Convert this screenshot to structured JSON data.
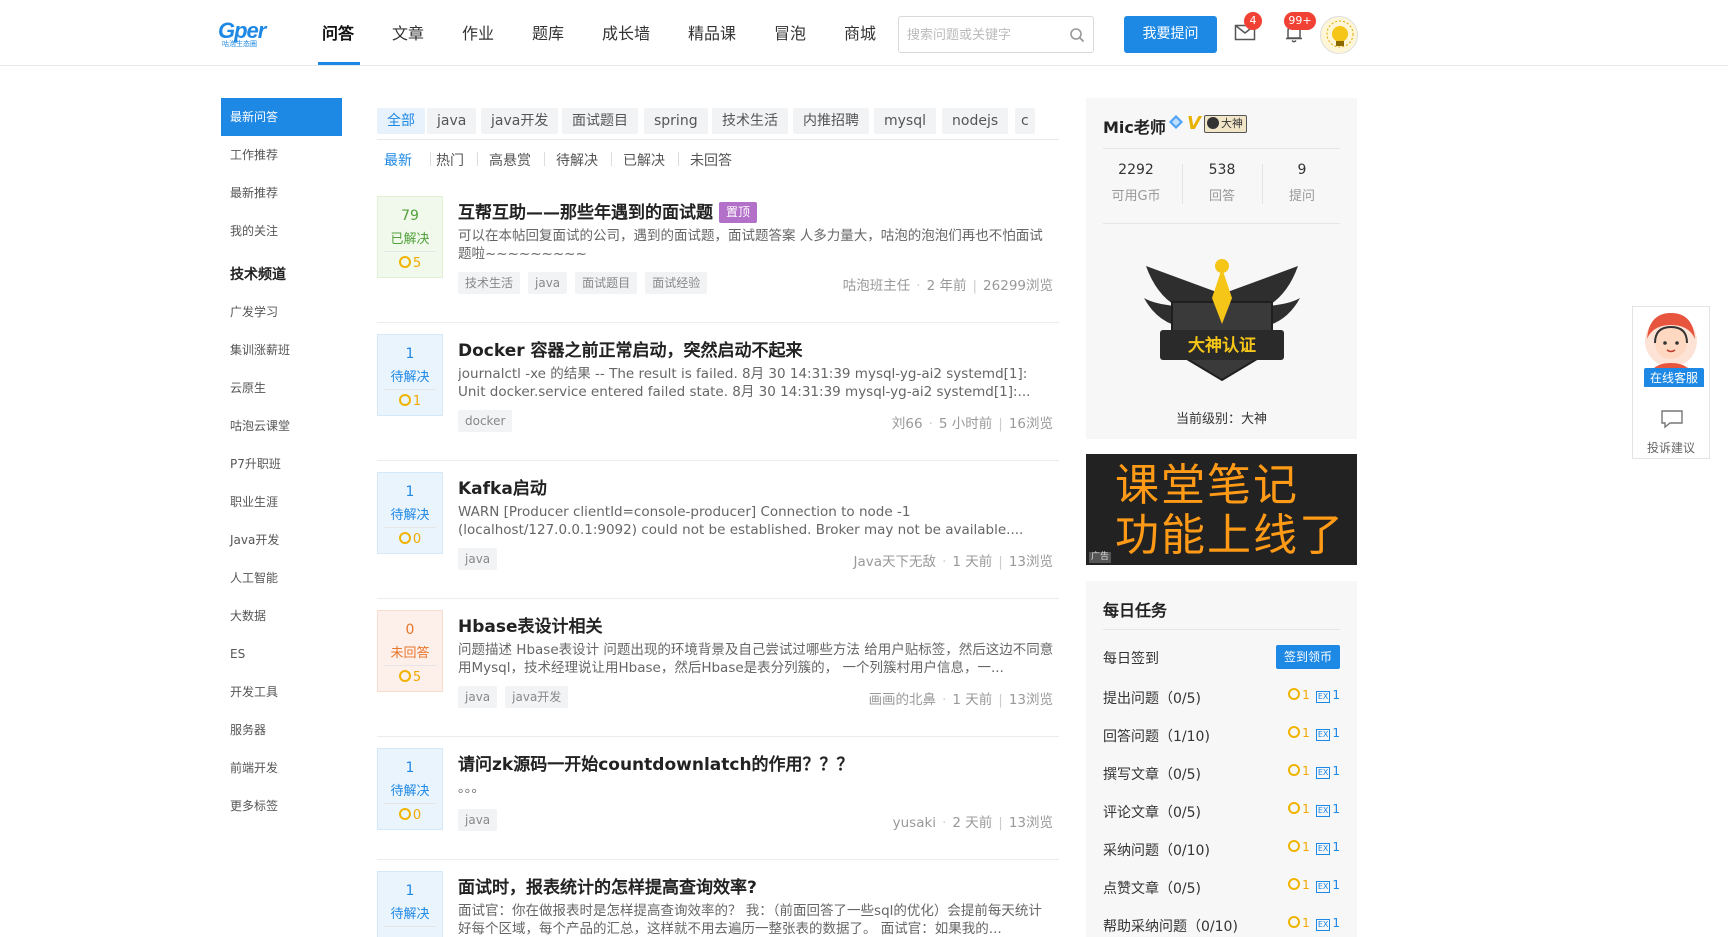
{
  "header": {
    "logo_text": "Gper",
    "logo_sub": "咕泡生态圈",
    "nav": [
      "问答",
      "文章",
      "作业",
      "题库",
      "成长墙",
      "精品课",
      "冒泡",
      "商城"
    ],
    "search_placeholder": "搜索问题或关键字",
    "ask_button": "我要提问",
    "mail_badge": "4",
    "bell_badge": "99+",
    "accent_color": "#1e88e5"
  },
  "sidebar": {
    "top_items": [
      "最新问答",
      "工作推荐",
      "最新推荐",
      "我的关注"
    ],
    "heading": "技术频道",
    "channels": [
      "广发学习",
      "集训涨薪班",
      "云原生",
      "咕泡云课堂",
      "P7升职班",
      "职业生涯",
      "Java开发",
      "人工智能",
      "大数据",
      "ES",
      "开发工具",
      "服务器",
      "前端开发",
      "更多标签"
    ]
  },
  "main": {
    "tags": [
      "全部",
      "java",
      "java开发",
      "面试题目",
      "spring",
      "技术生活",
      "内推招聘",
      "mysql",
      "nodejs",
      "c"
    ],
    "filters": [
      "最新",
      "热门",
      "高悬赏",
      "待解决",
      "已解决",
      "未回答"
    ],
    "questions": [
      {
        "count": "79",
        "status": "已解决",
        "state": "solved",
        "reward": "5",
        "title": "互帮互助——那些年遇到的面试题",
        "pin": "置顶",
        "desc": "可以在本帖回复面试的公司，遇到的面试题，面试题答案 人多力量大，咕泡的泡泡们再也不怕面试题啦~~~~~~~~~",
        "tags": [
          "技术生活",
          "java",
          "面试题目",
          "面试经验"
        ],
        "author": "咕泡班主任",
        "time": "2 年前",
        "views": "26299浏览"
      },
      {
        "count": "1",
        "status": "待解决",
        "state": "pending",
        "reward": "1",
        "title": "Docker 容器之前正常启动，突然启动不起来",
        "pin": "",
        "desc": "journalctl -xe 的结果 -- The result is failed. 8月 30 14:31:39 mysql-yg-ai2 systemd[1]: Unit docker.service entered failed state. 8月 30 14:31:39 mysql-yg-ai2 systemd[1]:...",
        "tags": [
          "docker"
        ],
        "author": "刘66",
        "time": "5 小时前",
        "views": "16浏览"
      },
      {
        "count": "1",
        "status": "待解决",
        "state": "pending",
        "reward": "0",
        "title": "Kafka启动",
        "pin": "",
        "desc": "WARN [Producer clientId=console-producer] Connection to node -1 (localhost/127.0.0.1:9092) could not be established. Broker may not be available....",
        "tags": [
          "java"
        ],
        "author": "Java天下无敌",
        "time": "1 天前",
        "views": "13浏览"
      },
      {
        "count": "0",
        "status": "未回答",
        "state": "unanswered",
        "reward": "5",
        "title": "Hbase表设计相关",
        "pin": "",
        "desc": "问题描述 Hbase表设计 问题出现的环境背景及自己尝试过哪些方法 给用户贴标签，然后这边不同意用Mysql，技术经理说让用Hbase，然后Hbase是表分列簇的， 一个列簇村用户信息，一...",
        "tags": [
          "java",
          "java开发"
        ],
        "author": "画画的北鼻",
        "time": "1 天前",
        "views": "13浏览"
      },
      {
        "count": "1",
        "status": "待解决",
        "state": "pending",
        "reward": "0",
        "title": "请问zk源码一开始countdownlatch的作用？？？",
        "pin": "",
        "desc": "。。。",
        "tags": [
          "java"
        ],
        "author": "yusaki",
        "time": "2 天前",
        "views": "13浏览"
      },
      {
        "count": "1",
        "status": "待解决",
        "state": "pending",
        "reward": "0",
        "title": "面试时，报表统计的怎样提高查询效率?",
        "pin": "",
        "desc": "面试官：你在做报表时是怎样提高查询效率的？ 我：（前面回答了一些sql的优化）会提前每天统计好每个区域，每个产品的汇总，这样就不用去遍历一整张表的数据了。 面试官：如果我的...",
        "tags": [],
        "author": "",
        "time": "",
        "views": ""
      }
    ]
  },
  "user_card": {
    "name": "Mic老师",
    "god_badge": "大神",
    "stats": [
      {
        "value": "2292",
        "label": "可用G币"
      },
      {
        "value": "538",
        "label": "回答"
      },
      {
        "value": "9",
        "label": "提问"
      }
    ],
    "emblem_text": "大神认证",
    "level_text": "当前级别：大神"
  },
  "ad": {
    "line1": "课堂笔记",
    "line2": "功能上线了",
    "tag": "广告"
  },
  "daily_tasks": {
    "title": "每日任务",
    "checkin_label": "每日签到",
    "checkin_button": "签到领币",
    "ex_label": "EX",
    "tasks": [
      {
        "label": "提出问题（0/5)",
        "coin": "1",
        "ex": "1"
      },
      {
        "label": "回答问题（1/10)",
        "coin": "1",
        "ex": "1"
      },
      {
        "label": "撰写文章（0/5)",
        "coin": "1",
        "ex": "1"
      },
      {
        "label": "评论文章（0/5)",
        "coin": "1",
        "ex": "1"
      },
      {
        "label": "采纳问题（0/10)",
        "coin": "1",
        "ex": "1"
      },
      {
        "label": "点赞文章（0/5)",
        "coin": "1",
        "ex": "1"
      },
      {
        "label": "帮助采纳问题（0/10)",
        "coin": "1",
        "ex": "1"
      }
    ]
  },
  "float_service": {
    "service_label": "在线客服",
    "complaint_label": "投诉建议"
  }
}
